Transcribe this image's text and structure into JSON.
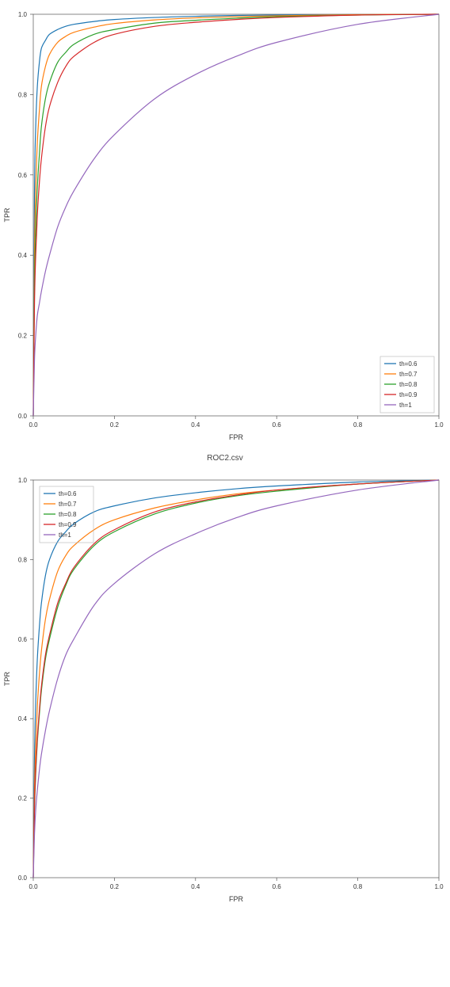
{
  "charts": [
    {
      "title": "",
      "xlabel": "FPR",
      "ylabel": "TPR",
      "legend_pos": "bottom-right",
      "x_ticks": [
        "0.0",
        "0.2",
        "0.4",
        "0.6",
        "0.8",
        "1.0"
      ],
      "y_ticks": [
        "0.0",
        "0.2",
        "0.4",
        "0.6",
        "0.8",
        "1.0"
      ]
    },
    {
      "title": "ROC2.csv",
      "xlabel": "FPR",
      "ylabel": "TPR",
      "legend_pos": "top-left",
      "x_ticks": [
        "0.0",
        "0.2",
        "0.4",
        "0.6",
        "0.8",
        "1.0"
      ],
      "y_ticks": [
        "0.0",
        "0.2",
        "0.4",
        "0.6",
        "0.8",
        "1.0"
      ]
    }
  ],
  "colors": {
    "th0.6": "#1f77b4",
    "th0.7": "#ff7f0e",
    "th0.8": "#2ca02c",
    "th0.9": "#d62728",
    "th1": "#9467bd"
  },
  "legend_labels": {
    "th0.6": "th=0.6",
    "th0.7": "th=0.7",
    "th0.8": "th=0.8",
    "th0.9": "th=0.9",
    "th1": "th=1"
  },
  "chart_data": [
    {
      "type": "line",
      "title": "",
      "xlabel": "FPR",
      "ylabel": "TPR",
      "xlim": [
        0,
        1
      ],
      "ylim": [
        0,
        1
      ],
      "legend_position": "lower right",
      "series": [
        {
          "name": "th=0.6",
          "x": [
            0,
            0.003,
            0.006,
            0.01,
            0.015,
            0.02,
            0.03,
            0.04,
            0.06,
            0.08,
            0.1,
            0.15,
            0.2,
            0.3,
            0.4,
            0.5,
            0.6,
            0.8,
            1.0
          ],
          "y": [
            0,
            0.55,
            0.72,
            0.82,
            0.88,
            0.915,
            0.935,
            0.95,
            0.962,
            0.97,
            0.975,
            0.982,
            0.987,
            0.992,
            0.995,
            0.997,
            0.998,
            0.999,
            1.0
          ]
        },
        {
          "name": "th=0.7",
          "x": [
            0,
            0.003,
            0.006,
            0.01,
            0.015,
            0.02,
            0.03,
            0.04,
            0.06,
            0.08,
            0.1,
            0.15,
            0.2,
            0.3,
            0.4,
            0.5,
            0.6,
            0.8,
            1.0
          ],
          "y": [
            0,
            0.4,
            0.56,
            0.68,
            0.76,
            0.82,
            0.87,
            0.9,
            0.93,
            0.945,
            0.955,
            0.968,
            0.977,
            0.986,
            0.991,
            0.994,
            0.996,
            0.999,
            1.0
          ]
        },
        {
          "name": "th=0.8",
          "x": [
            0,
            0.003,
            0.006,
            0.01,
            0.015,
            0.02,
            0.03,
            0.04,
            0.06,
            0.08,
            0.1,
            0.15,
            0.2,
            0.3,
            0.4,
            0.5,
            0.6,
            0.8,
            1.0
          ],
          "y": [
            0,
            0.32,
            0.46,
            0.57,
            0.65,
            0.72,
            0.79,
            0.83,
            0.88,
            0.905,
            0.925,
            0.95,
            0.962,
            0.978,
            0.985,
            0.99,
            0.994,
            0.998,
            1.0
          ]
        },
        {
          "name": "th=0.9",
          "x": [
            0,
            0.003,
            0.006,
            0.01,
            0.015,
            0.02,
            0.03,
            0.04,
            0.06,
            0.08,
            0.1,
            0.15,
            0.2,
            0.3,
            0.4,
            0.5,
            0.6,
            0.8,
            1.0
          ],
          "y": [
            0,
            0.28,
            0.4,
            0.5,
            0.58,
            0.64,
            0.72,
            0.77,
            0.83,
            0.87,
            0.895,
            0.93,
            0.95,
            0.97,
            0.98,
            0.987,
            0.992,
            0.998,
            1.0
          ]
        },
        {
          "name": "th=1",
          "x": [
            0,
            0.003,
            0.006,
            0.01,
            0.015,
            0.02,
            0.03,
            0.04,
            0.06,
            0.08,
            0.1,
            0.15,
            0.2,
            0.3,
            0.4,
            0.5,
            0.6,
            0.8,
            1.0
          ],
          "y": [
            0,
            0.14,
            0.2,
            0.25,
            0.28,
            0.31,
            0.36,
            0.4,
            0.47,
            0.52,
            0.56,
            0.64,
            0.7,
            0.79,
            0.85,
            0.895,
            0.93,
            0.975,
            1.0
          ]
        }
      ]
    },
    {
      "type": "line",
      "title": "ROC2.csv",
      "xlabel": "FPR",
      "ylabel": "TPR",
      "xlim": [
        0,
        1
      ],
      "ylim": [
        0,
        1
      ],
      "legend_position": "upper left",
      "series": [
        {
          "name": "th=0.6",
          "x": [
            0,
            0.003,
            0.006,
            0.01,
            0.015,
            0.02,
            0.03,
            0.04,
            0.06,
            0.08,
            0.1,
            0.15,
            0.2,
            0.3,
            0.4,
            0.5,
            0.6,
            0.8,
            1.0
          ],
          "y": [
            0,
            0.3,
            0.44,
            0.55,
            0.63,
            0.69,
            0.76,
            0.8,
            0.845,
            0.87,
            0.89,
            0.92,
            0.935,
            0.955,
            0.968,
            0.978,
            0.985,
            0.995,
            1.0
          ]
        },
        {
          "name": "th=0.7",
          "x": [
            0,
            0.003,
            0.006,
            0.01,
            0.015,
            0.02,
            0.03,
            0.04,
            0.06,
            0.08,
            0.1,
            0.15,
            0.2,
            0.3,
            0.4,
            0.5,
            0.6,
            0.8,
            1.0
          ],
          "y": [
            0,
            0.22,
            0.33,
            0.43,
            0.51,
            0.57,
            0.65,
            0.7,
            0.77,
            0.81,
            0.835,
            0.875,
            0.9,
            0.93,
            0.95,
            0.965,
            0.975,
            0.99,
            1.0
          ]
        },
        {
          "name": "th=0.8",
          "x": [
            0,
            0.003,
            0.006,
            0.01,
            0.015,
            0.02,
            0.03,
            0.04,
            0.06,
            0.08,
            0.1,
            0.15,
            0.2,
            0.3,
            0.4,
            0.5,
            0.6,
            0.8,
            1.0
          ],
          "y": [
            0,
            0.17,
            0.26,
            0.34,
            0.41,
            0.47,
            0.55,
            0.6,
            0.68,
            0.735,
            0.775,
            0.835,
            0.87,
            0.915,
            0.942,
            0.96,
            0.972,
            0.99,
            1.0
          ]
        },
        {
          "name": "th=0.9",
          "x": [
            0,
            0.003,
            0.006,
            0.01,
            0.015,
            0.02,
            0.03,
            0.04,
            0.06,
            0.08,
            0.1,
            0.15,
            0.2,
            0.3,
            0.4,
            0.5,
            0.6,
            0.8,
            1.0
          ],
          "y": [
            0,
            0.18,
            0.27,
            0.35,
            0.42,
            0.48,
            0.56,
            0.61,
            0.69,
            0.74,
            0.78,
            0.84,
            0.875,
            0.92,
            0.945,
            0.962,
            0.975,
            0.99,
            1.0
          ]
        },
        {
          "name": "th=1",
          "x": [
            0,
            0.003,
            0.006,
            0.01,
            0.015,
            0.02,
            0.03,
            0.04,
            0.06,
            0.08,
            0.1,
            0.15,
            0.2,
            0.3,
            0.4,
            0.5,
            0.6,
            0.8,
            1.0
          ],
          "y": [
            0,
            0.11,
            0.17,
            0.22,
            0.27,
            0.31,
            0.37,
            0.42,
            0.5,
            0.56,
            0.6,
            0.685,
            0.74,
            0.815,
            0.865,
            0.905,
            0.935,
            0.975,
            1.0
          ]
        }
      ]
    }
  ]
}
